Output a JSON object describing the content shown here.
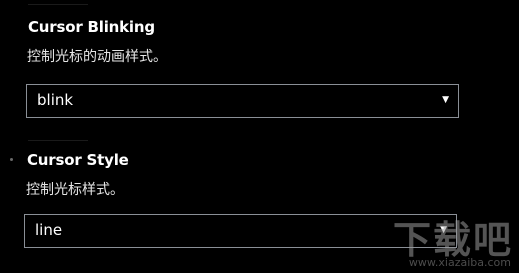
{
  "settings": [
    {
      "title": "Cursor Blinking",
      "description": "控制光标的动画样式。",
      "value": "blink"
    },
    {
      "title": "Cursor Style",
      "description": "控制光标样式。",
      "value": "line"
    }
  ],
  "dropdown_arrow": "▼",
  "watermark": {
    "text": "下载吧",
    "url": "www.xiazaiba.com"
  }
}
